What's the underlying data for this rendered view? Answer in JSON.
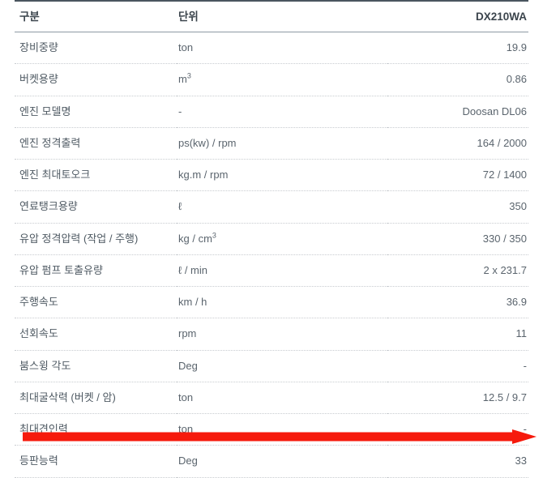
{
  "table": {
    "headers": {
      "label": "구분",
      "unit": "단위",
      "value": "DX210WA"
    },
    "rows": [
      {
        "label": "장비중량",
        "unit": "ton",
        "unit_sup": "",
        "value": "19.9"
      },
      {
        "label": "버켓용량",
        "unit": "m",
        "unit_sup": "3",
        "value": "0.86"
      },
      {
        "label": "엔진 모델명",
        "unit": "-",
        "unit_sup": "",
        "value": "Doosan DL06"
      },
      {
        "label": "엔진 정격출력",
        "unit": "ps(kw) / rpm",
        "unit_sup": "",
        "value": "164 / 2000"
      },
      {
        "label": "엔진 최대토오크",
        "unit": "kg.m / rpm",
        "unit_sup": "",
        "value": "72 / 1400"
      },
      {
        "label": "연료탱크용량",
        "unit": "ℓ",
        "unit_sup": "",
        "value": "350"
      },
      {
        "label": "유압 정격압력 (작업 / 주행)",
        "unit": "kg / cm",
        "unit_sup": "3",
        "value": "330 / 350"
      },
      {
        "label": "유압 펌프 토출유량",
        "unit": "ℓ / min",
        "unit_sup": "",
        "value": "2 x 231.7"
      },
      {
        "label": "주행속도",
        "unit": "km / h",
        "unit_sup": "",
        "value": "36.9"
      },
      {
        "label": "선회속도",
        "unit": "rpm",
        "unit_sup": "",
        "value": "11"
      },
      {
        "label": "붐스윙 각도",
        "unit": "Deg",
        "unit_sup": "",
        "value": "-"
      },
      {
        "label": "최대굴삭력 (버켓 / 암)",
        "unit": "ton",
        "unit_sup": "",
        "value": "12.5 / 9.7"
      },
      {
        "label": "최대견인력",
        "unit": "ton",
        "unit_sup": "",
        "value": "-"
      },
      {
        "label": "등판능력",
        "unit": "Deg",
        "unit_sup": "",
        "value": "33"
      }
    ]
  },
  "annotation": {
    "type": "arrow-right",
    "color": "#f61a0c"
  }
}
